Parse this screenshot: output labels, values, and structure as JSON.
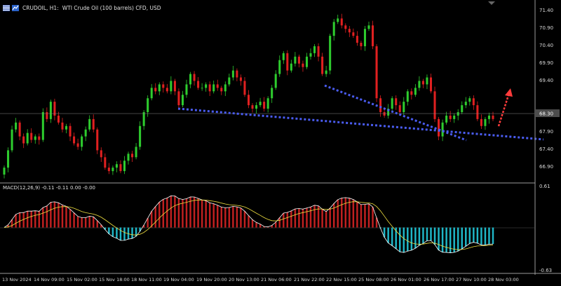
{
  "header": {
    "symbol": "CRUDOIL, H1:",
    "description": "WTI Crude Oil (100 barrels) CFD, USD",
    "icons": [
      "flag-icon",
      "chart-type-icon"
    ]
  },
  "macd": {
    "label": "MACD(12,26,9) -0.11 -0.11 0.00 -0.00",
    "axis_top": "0.61",
    "axis_bottom": "-0.63"
  },
  "price_axis": {
    "labels": [
      "71.40",
      "70.90",
      "70.40",
      "69.90",
      "69.40",
      "67.90",
      "67.40",
      "66.90"
    ],
    "current_price": "68.30"
  },
  "time_axis": {
    "labels": [
      "13 Nov 2024",
      "14 Nov 09:00",
      "15 Nov 02:00",
      "15 Nov 18:00",
      "18 Nov 11:00",
      "19 Nov 04:00",
      "19 Nov 20:00",
      "20 Nov 13:00",
      "21 Nov 06:00",
      "21 Nov 22:00",
      "22 Nov 15:00",
      "25 Nov 08:00",
      "26 Nov 01:00",
      "26 Nov 17:00",
      "27 Nov 10:00",
      "28 Nov 03:00"
    ]
  },
  "colors": {
    "background": "#000000",
    "bull_candle": "#2ecc2e",
    "bear_candle": "#e02020",
    "trendline": "#4a5cf0",
    "forecast_arrow": "#ff3b3b",
    "macd_hist_pos": "#c02020",
    "macd_hist_neg": "#1fb6c6",
    "macd_line": "#ffffff",
    "signal_line": "#f0e040",
    "current_price_line": "#888888"
  },
  "chart_data": {
    "type": "candlestick",
    "symbol": "CRUDOIL",
    "timeframe": "H1",
    "y_range": [
      66.7,
      71.55
    ],
    "current_price": 68.3,
    "close_series": [
      67.0,
      67.5,
      68.1,
      68.3,
      67.9,
      67.7,
      68.0,
      67.8,
      67.9,
      67.8,
      68.6,
      68.4,
      68.9,
      68.5,
      68.3,
      68.1,
      68.2,
      67.9,
      67.7,
      67.6,
      67.9,
      68.1,
      68.4,
      68.1,
      67.5,
      67.3,
      67.0,
      66.9,
      67.0,
      67.1,
      66.9,
      67.2,
      67.4,
      67.3,
      67.6,
      68.2,
      68.6,
      69.0,
      69.3,
      69.2,
      69.4,
      69.3,
      69.2,
      69.5,
      69.2,
      68.8,
      69.1,
      69.4,
      69.7,
      69.5,
      69.3,
      69.3,
      69.4,
      69.2,
      69.4,
      69.3,
      69.2,
      69.4,
      69.6,
      69.8,
      69.6,
      69.5,
      69.1,
      68.8,
      68.7,
      68.8,
      68.9,
      68.7,
      69.0,
      69.3,
      69.7,
      70.1,
      70.3,
      69.8,
      70.0,
      70.2,
      70.0,
      69.9,
      70.2,
      70.3,
      70.5,
      70.2,
      69.7,
      69.8,
      70.8,
      71.2,
      71.3,
      71.1,
      71.0,
      70.9,
      70.8,
      70.6,
      70.5,
      71.0,
      71.1,
      70.5,
      69.0,
      68.6,
      68.5,
      68.7,
      69.0,
      68.8,
      68.6,
      68.9,
      69.2,
      69.1,
      69.3,
      69.5,
      69.4,
      69.6,
      69.2,
      68.4,
      67.9,
      68.3,
      68.5,
      68.4,
      68.5,
      68.6,
      68.8,
      68.9,
      69.0,
      68.8,
      68.4,
      68.2,
      68.4,
      68.5,
      68.4
    ],
    "trendlines": [
      {
        "from": [
          "19 Nov 04:00",
          68.48
        ],
        "to": [
          "28 Nov 03:00+",
          67.62
        ]
      },
      {
        "from": [
          "21 Nov 22:00",
          69.25
        ],
        "to": [
          "27 Nov 10:00+",
          67.7
        ]
      }
    ],
    "macd": {
      "params": [
        12,
        26,
        9
      ],
      "ylim": [
        -0.63,
        0.61
      ],
      "values": [
        -0.11,
        -0.11,
        0.0,
        -0.0
      ]
    }
  }
}
